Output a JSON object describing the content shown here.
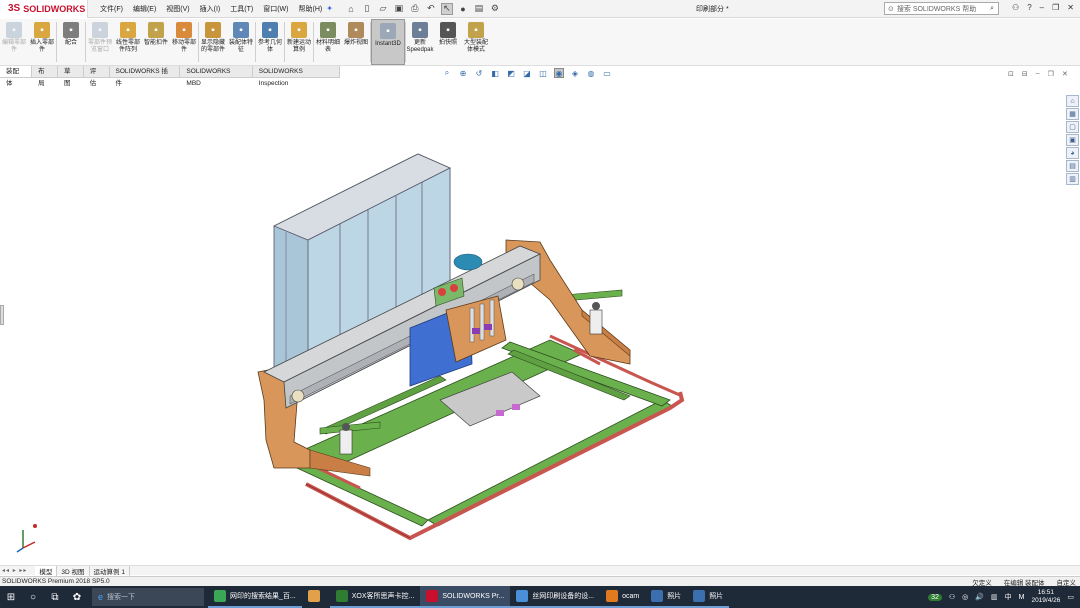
{
  "app": {
    "logo": "SOLIDWORKS",
    "doc_title": "印刷部分 *"
  },
  "menu": [
    "文件(F)",
    "编辑(E)",
    "视图(V)",
    "插入(I)",
    "工具(T)",
    "窗口(W)",
    "帮助(H)"
  ],
  "search": {
    "placeholder": "搜索 SOLIDWORKS 帮助"
  },
  "ribbon": [
    {
      "label": "编辑零部件",
      "icon": "edit-component-icon",
      "color": "#8aa0b8",
      "dim": true
    },
    {
      "label": "插入零部件",
      "icon": "insert-component-icon",
      "color": "#d9a640"
    },
    {
      "label": "配合",
      "icon": "mate-icon",
      "color": "#7d7d7d"
    },
    {
      "label": "零部件预览窗口",
      "icon": "preview-window-icon",
      "color": "#8aa0b8",
      "dim": true
    },
    {
      "label": "线性零部件阵列",
      "icon": "linear-pattern-icon",
      "color": "#d9a640"
    },
    {
      "label": "智能扣件",
      "icon": "smart-fastener-icon",
      "color": "#c2a24a"
    },
    {
      "label": "移动零部件",
      "icon": "move-component-icon",
      "color": "#d98a3a"
    },
    {
      "label": "显示隐藏的零部件",
      "icon": "show-hidden-icon",
      "color": "#c9953b"
    },
    {
      "label": "装配体特征",
      "icon": "assembly-feature-icon",
      "color": "#5f88b8"
    },
    {
      "label": "参考几何体",
      "icon": "reference-geometry-icon",
      "color": "#4f7fb0"
    },
    {
      "label": "新建运动算例",
      "icon": "motion-study-icon",
      "color": "#d9a640"
    },
    {
      "label": "材料明细表",
      "icon": "bom-icon",
      "color": "#7b8d60"
    },
    {
      "label": "爆炸视图",
      "icon": "exploded-view-icon",
      "color": "#b08a5a"
    },
    {
      "label": "Instant3D",
      "icon": "instant3d-icon",
      "color": "#9aa8b8",
      "selected": true
    },
    {
      "label": "更新Speedpak",
      "icon": "speedpak-icon",
      "color": "#6d7f96"
    },
    {
      "label": "拍快照",
      "icon": "snapshot-icon",
      "color": "#555555"
    },
    {
      "label": "大型装配体模式",
      "icon": "large-assembly-icon",
      "color": "#c2a24a"
    }
  ],
  "command_tabs": [
    "装配体",
    "布局",
    "草图",
    "评估",
    "SOLIDWORKS 插件",
    "SOLIDWORKS MBD",
    "SOLIDWORKS Inspection"
  ],
  "bottom_tabs": [
    "模型",
    "3D 视图",
    "运动算例 1"
  ],
  "status": {
    "left": "SOLIDWORKS Premium 2018 SP5.0",
    "right": [
      "欠定义",
      "在编辑 装配体",
      "自定义"
    ]
  },
  "taskbar": {
    "search_placeholder": "搜索一下",
    "apps": [
      {
        "label": "网印的搜索结果_百...",
        "color": "#3aa757",
        "icon": "browser-icon"
      },
      {
        "label": "",
        "color": "#e2a04a",
        "icon": "pen-icon"
      },
      {
        "label": "XOX客所思声卡控...",
        "color": "#2e7d32",
        "icon": "xox-icon"
      },
      {
        "label": "SOLIDWORKS Pr...",
        "color": "#c8102e",
        "icon": "solidworks-icon",
        "active": true
      },
      {
        "label": "丝网印刷设备的设...",
        "color": "#4a90d9",
        "icon": "word-icon"
      },
      {
        "label": "ocam",
        "color": "#e07a1f",
        "icon": "ocam-icon"
      },
      {
        "label": "照片",
        "color": "#3b6fb0",
        "icon": "photos-icon"
      },
      {
        "label": "照片",
        "color": "#3b6fb0",
        "icon": "photos-icon"
      }
    ],
    "tray_ime": "中",
    "tray_badge": "32",
    "time": "16:51",
    "date": "2019/4/26"
  },
  "colors": {
    "accent": "#c8102e",
    "frame_green": "#6ab04c",
    "orange_plate": "#d9965a",
    "blue_plate": "#3f6fd1",
    "taskbar": "#1f2a38"
  }
}
